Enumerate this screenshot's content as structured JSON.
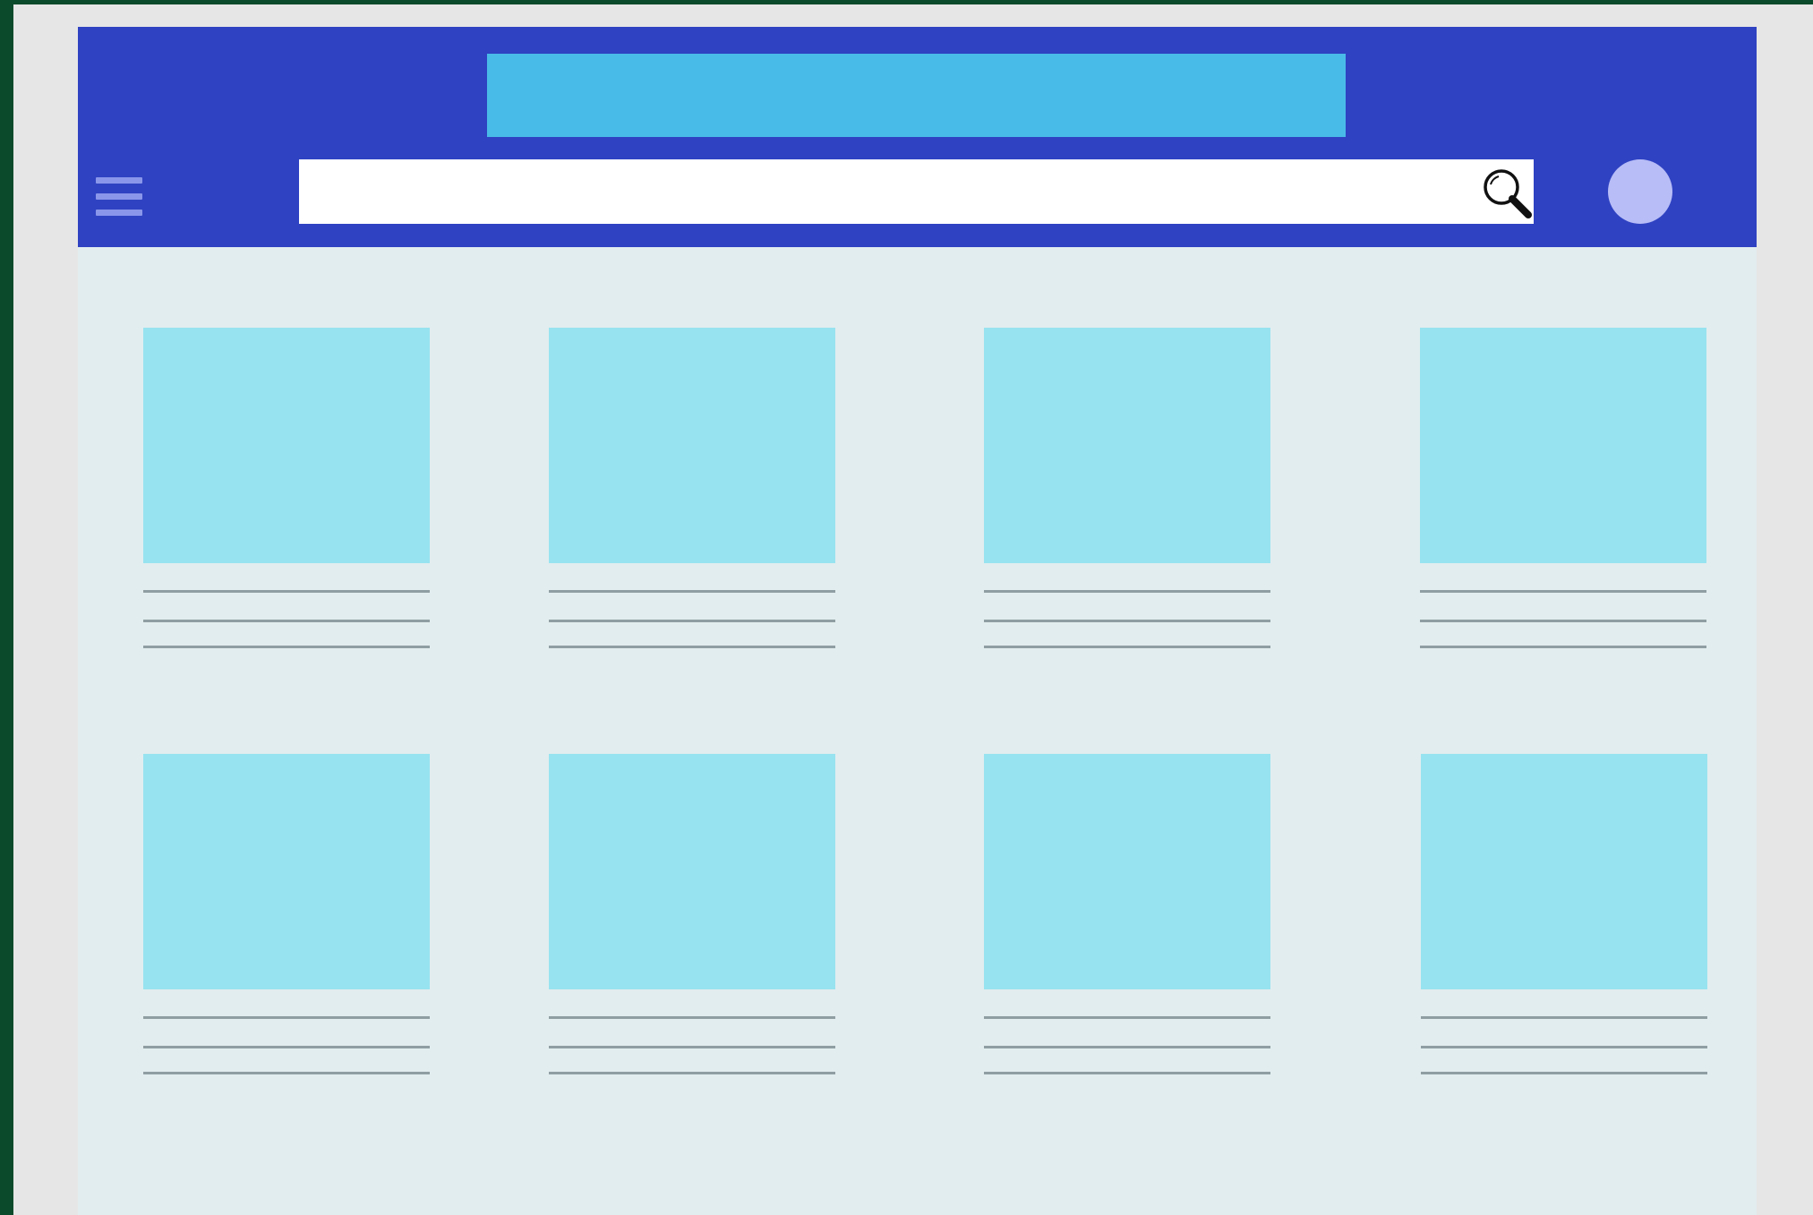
{
  "header": {
    "title": "",
    "menu_icon": "hamburger-menu-icon",
    "search": {
      "value": "",
      "placeholder": "",
      "icon": "magnifier-icon"
    },
    "avatar_icon": "user-avatar"
  },
  "colors": {
    "header_background": "#2f42c2",
    "title_banner": "#49bbe8",
    "content_background": "#e2edef",
    "card_placeholder": "#97e3f0",
    "text_line": "#8f9ea2",
    "avatar": "#b8bdf7",
    "menu_icon": "#8a96ea",
    "frame_border": "#0b4a2b"
  },
  "grid": {
    "rows": 2,
    "columns": 4,
    "cards": [
      {
        "title": "",
        "subtitle": "",
        "caption": ""
      },
      {
        "title": "",
        "subtitle": "",
        "caption": ""
      },
      {
        "title": "",
        "subtitle": "",
        "caption": ""
      },
      {
        "title": "",
        "subtitle": "",
        "caption": ""
      },
      {
        "title": "",
        "subtitle": "",
        "caption": ""
      },
      {
        "title": "",
        "subtitle": "",
        "caption": ""
      },
      {
        "title": "",
        "subtitle": "",
        "caption": ""
      },
      {
        "title": "",
        "subtitle": "",
        "caption": ""
      }
    ]
  }
}
